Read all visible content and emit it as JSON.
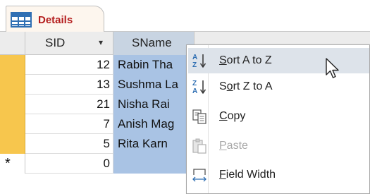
{
  "tab": {
    "label": "Details",
    "icon": "table-icon",
    "label_color": "#b41d1d"
  },
  "table": {
    "columns": [
      {
        "label": "SID",
        "dropdown": "▾"
      },
      {
        "label": "SName"
      },
      {
        "label": ""
      }
    ],
    "rows": [
      {
        "sid": "12",
        "sname": "Rabin Tha"
      },
      {
        "sid": "13",
        "sname": "Sushma La"
      },
      {
        "sid": "21",
        "sname": "Nisha Rai"
      },
      {
        "sid": "7",
        "sname": "Anish Mag"
      },
      {
        "sid": "5",
        "sname": "Rita Karn"
      }
    ],
    "new_row": {
      "marker": "*",
      "sid": "0"
    }
  },
  "context_menu": {
    "items": [
      {
        "icon": "sort-a-to-z-icon",
        "pre": "",
        "key": "S",
        "post": "ort A to Z",
        "state": "hover"
      },
      {
        "icon": "sort-z-to-a-icon",
        "pre": "S",
        "key": "o",
        "post": "rt Z to A",
        "state": "normal"
      },
      {
        "icon": "copy-icon",
        "pre": "",
        "key": "C",
        "post": "opy",
        "state": "normal"
      },
      {
        "icon": "paste-icon",
        "pre": "",
        "key": "P",
        "post": "aste",
        "state": "disabled"
      },
      {
        "icon": "field-width-icon",
        "pre": "",
        "key": "F",
        "post": "ield Width",
        "state": "normal"
      }
    ]
  },
  "colors": {
    "record_selector": "#f7c64d",
    "selected_column": "#a9c3e4",
    "menu_hover": "#dde3ea"
  }
}
